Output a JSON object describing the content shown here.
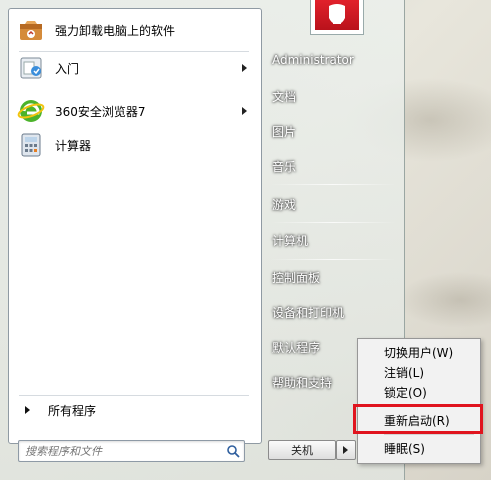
{
  "programs": [
    {
      "label": "强力卸载电脑上的软件",
      "icon": "uninstaller-box-icon",
      "has_submenu": false
    },
    {
      "label": "入门",
      "icon": "getting-started-icon",
      "has_submenu": true
    },
    {
      "label": "360安全浏览器7",
      "icon": "browser-360-icon",
      "has_submenu": true
    },
    {
      "label": "计算器",
      "icon": "calculator-icon",
      "has_submenu": false
    }
  ],
  "all_programs_label": "所有程序",
  "search": {
    "placeholder": "搜索程序和文件"
  },
  "right_pane": {
    "user": "Administrator",
    "items": [
      "文档",
      "图片",
      "音乐",
      "游戏",
      "计算机",
      "控制面板",
      "设备和打印机",
      "默认程序",
      "帮助和支持"
    ]
  },
  "shutdown_label": "关机",
  "context_menu": {
    "items": [
      "切换用户(W)",
      "注销(L)",
      "锁定(O)",
      "重新启动(R)",
      "睡眠(S)"
    ],
    "highlighted": "重新启动(R)"
  },
  "colors": {
    "highlight_border": "#e0141e",
    "avatar_red": "#d01a24"
  }
}
